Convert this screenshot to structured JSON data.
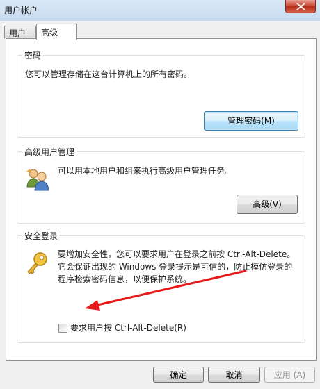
{
  "window": {
    "title": "用户帐户",
    "close_icon": "close-icon"
  },
  "tabs": [
    {
      "label": "用户",
      "selected": false
    },
    {
      "label": "高级",
      "selected": true
    }
  ],
  "passwords_group": {
    "title": "密码",
    "description": "您可以管理存储在这台计算机上的所有密码。",
    "button_label": "管理密码(M)"
  },
  "advanced_group": {
    "title": "高级用户管理",
    "icon": "users-icon",
    "description": "可以用本地用户和组来执行高级用户管理任务。",
    "button_label": "高级(V)"
  },
  "secure_logon_group": {
    "title": "安全登录",
    "icon": "key-icon",
    "description_lines": [
      "要增加安全性，您可以要求用户在登录之前按 Ctrl-Alt-Delete。",
      "它会保证出现的 Windows 登录提示是可信的，防止模仿登录的",
      "程序检索密码信息，以便保护系统。"
    ],
    "checkbox_label": "要求用户按 Ctrl-Alt-Delete(R)",
    "checkbox_checked": false
  },
  "annotation": {
    "arrow_color": "#e8191b"
  },
  "footer": {
    "ok_label": "确定",
    "cancel_label": "取消",
    "apply_label": "应用 (A)",
    "apply_enabled": false
  }
}
